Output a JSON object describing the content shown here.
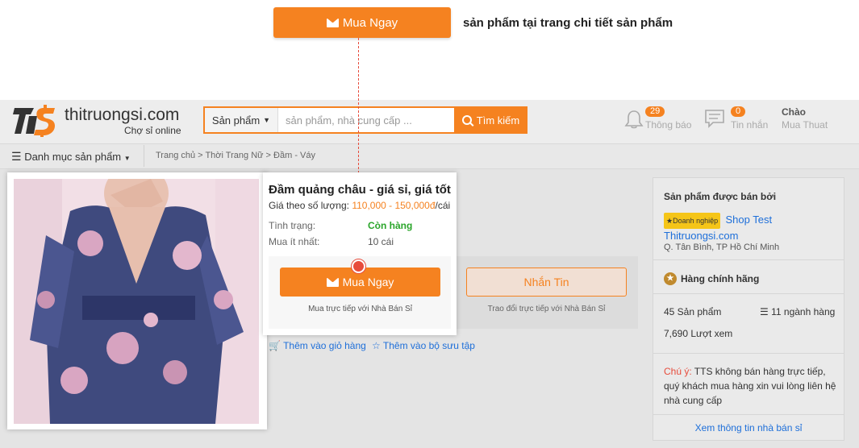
{
  "annotation": {
    "button_label": "Mua Ngay",
    "note": "sản phẩm tại trang chi tiết sản phẩm"
  },
  "header": {
    "logo_text": "thitruongsi.com",
    "logo_sub": "Chợ sỉ online",
    "search": {
      "category": "Sản phẩm",
      "placeholder": "sản phẩm, nhà cung cấp ...",
      "button": "Tìm kiếm"
    },
    "notifications": {
      "count": "29",
      "label": "Thông báo"
    },
    "messages": {
      "count": "0",
      "label": "Tin nhắn"
    },
    "greeting": "Chào",
    "user": "Mua Thuat"
  },
  "nav": {
    "menu": "Danh mục sản phẩm",
    "breadcrumb": "Trang chủ  > Thời Trang Nữ > Đầm - Váy"
  },
  "product": {
    "title": "Đầm quảng châu - giá sỉ, giá tốt",
    "price_label": "Giá theo số lượng:",
    "price_value": "110,000 - 150,000đ",
    "price_unit": "/cái",
    "status_label": "Tình trạng:",
    "status_value": "Còn hàng",
    "min_label": "Mua ít nhất:",
    "min_value": "10 cái",
    "buy_button": "Mua Ngay",
    "buy_sub": "Mua trực tiếp với Nhà Bán Sỉ",
    "message_button": "Nhắn Tin",
    "message_sub": "Trao đổi trực tiếp với Nhà Bán Sỉ",
    "add_cart": "Thêm vào giỏ hàng",
    "add_collection": "Thêm vào bộ sưu tập"
  },
  "seller": {
    "heading": "Sản phẩm được bán bởi",
    "badge": "Doanh nghiệp",
    "name_line1": "Shop Test",
    "name_line2": "Thitruongsi.com",
    "location": "Q. Tân Bình, TP Hồ Chí Minh",
    "genuine": "Hàng chính hãng",
    "products": "45 Sản phẩm",
    "categories": "11 ngành hàng",
    "views": "7,690 Lượt xem",
    "note_label": "Chú ý:",
    "note_text": " TTS không bán hàng trực tiếp, quý khách mua hàng xin vui lòng liên hệ nhà cung cấp",
    "view_info": "Xem thông tin nhà bán sỉ"
  },
  "colors": {
    "accent": "#f58220",
    "connector": "#e74c3c",
    "link": "#1e6fd9",
    "in_stock": "#2aa52a"
  }
}
